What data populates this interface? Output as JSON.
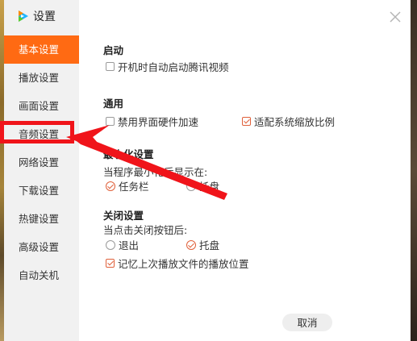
{
  "app": {
    "title": "设置",
    "logo_icon": "tencent-video-logo-icon"
  },
  "close_icon": "close-icon",
  "sidebar": {
    "items": [
      {
        "label": "基本设置",
        "active": true
      },
      {
        "label": "播放设置",
        "active": false
      },
      {
        "label": "画面设置",
        "active": false
      },
      {
        "label": "音频设置",
        "active": false
      },
      {
        "label": "网络设置",
        "active": false
      },
      {
        "label": "下载设置",
        "active": false
      },
      {
        "label": "热键设置",
        "active": false
      },
      {
        "label": "高级设置",
        "active": false
      },
      {
        "label": "自动关机",
        "active": false
      }
    ]
  },
  "sections": {
    "startup": {
      "title": "启动",
      "options": [
        {
          "label": "开机时自动启动腾讯视频",
          "checked": false
        }
      ]
    },
    "general": {
      "title": "通用",
      "options": [
        {
          "label": "禁用界面硬件加速",
          "checked": false
        },
        {
          "label": "适配系统缩放比例",
          "checked": true
        }
      ]
    },
    "minimize": {
      "title": "最小化设置",
      "caption": "当程序最小化后显示在:",
      "options": [
        {
          "label": "任务栏",
          "selected": true
        },
        {
          "label": "托盘",
          "selected": false
        }
      ]
    },
    "close": {
      "title": "关闭设置",
      "caption": "当点击关闭按钮后:",
      "options": [
        {
          "label": "退出",
          "selected": false
        },
        {
          "label": "托盘",
          "selected": true
        }
      ],
      "remember": {
        "label": "记忆上次播放文件的播放位置",
        "checked": true
      }
    }
  },
  "footer": {
    "cancel_label": "取消"
  },
  "annotation": {
    "color": "#f0141a",
    "target": "音频设置"
  },
  "colors": {
    "accent": "#ff6a13",
    "check": "#e0603a",
    "sidebar_bg": "#f1f1f1"
  }
}
